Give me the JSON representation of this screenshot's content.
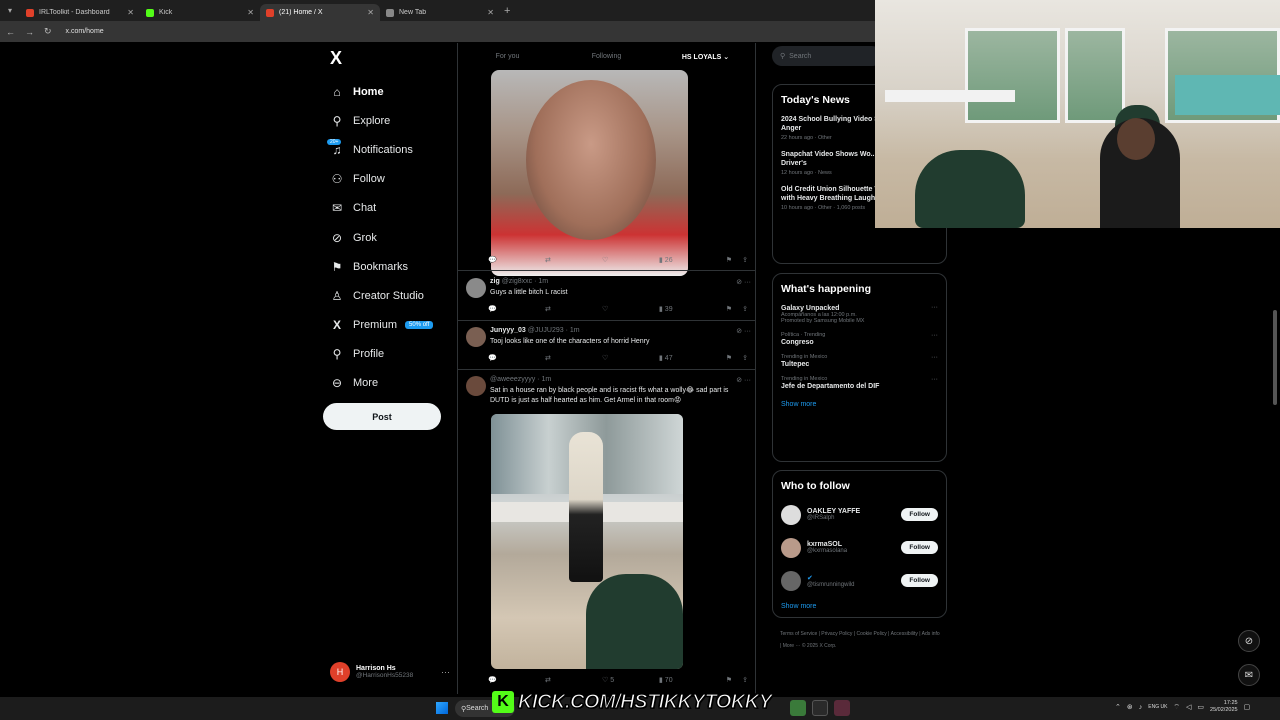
{
  "browser": {
    "tabs": [
      {
        "label": "IRLToolkit - Dashboard",
        "color": "#e0402a"
      },
      {
        "label": "Kick",
        "color": "#53fc18"
      },
      {
        "label": "(21) Home / X",
        "color": "#e0402a",
        "active": true
      },
      {
        "label": "New Tab",
        "color": "#888888"
      }
    ],
    "url": "x.com/home"
  },
  "sidebar": {
    "logo": "X",
    "items": [
      {
        "label": "Home",
        "icon": "home-icon",
        "glyph": "⌂"
      },
      {
        "label": "Explore",
        "icon": "search-icon",
        "glyph": "⚲"
      },
      {
        "label": "Notifications",
        "icon": "bell-icon",
        "glyph": "🔔",
        "badge": "20+"
      },
      {
        "label": "Follow",
        "icon": "follow-icon",
        "glyph": "👤"
      },
      {
        "label": "Chat",
        "icon": "mail-icon",
        "glyph": "✉"
      },
      {
        "label": "Grok",
        "icon": "grok-icon",
        "glyph": "⊘"
      },
      {
        "label": "Bookmarks",
        "icon": "bookmark-icon",
        "glyph": "🔖"
      },
      {
        "label": "Creator Studio",
        "icon": "creator-studio-icon",
        "glyph": "♙"
      },
      {
        "label": "Premium",
        "icon": "premium-x-icon",
        "glyph": "X",
        "pill": "50% off"
      },
      {
        "label": "Profile",
        "icon": "profile-icon",
        "glyph": "👤"
      },
      {
        "label": "More",
        "icon": "more-icon",
        "glyph": "⊖"
      }
    ],
    "post_label": "Post",
    "account": {
      "initial": "H",
      "name": "Harrison Hs",
      "handle": "@HarrisonHs55238"
    }
  },
  "feed": {
    "tabs": [
      "For you",
      "Following",
      "HS LOYALS ⌄"
    ],
    "actions1": {
      "views": "26"
    },
    "tweets": [
      {
        "name": "zig",
        "handle": "@zig8xxc",
        "time": "1m",
        "text": "Guys a little bitch L racist",
        "views": "39"
      },
      {
        "name": "Junyyy_03",
        "handle": "@JUJU293",
        "time": "1m",
        "text": "Tooj looks like one of the characters of horrid Henry",
        "views": "47"
      },
      {
        "name": "",
        "handle": "@aweeezyyyy",
        "time": "1m",
        "text": "Sat in a house ran by black people and is racist ffs what a wolly😂 sad part is DUTD is just as half hearted as him. Get Armel in that room😡",
        "likes": "5",
        "views": "70"
      }
    ]
  },
  "right": {
    "search_placeholder": "Search",
    "news": {
      "title": "Today's News",
      "items": [
        {
          "title": "2024 School Bullying Video Sparks Renewed Anger",
          "meta": "22 hours ago · Other"
        },
        {
          "title": "Snapchat Video Shows Wo... Gun at Rideshare Driver's",
          "meta": "12 hours ago · News"
        },
        {
          "title": "Old Credit Union Silhouette Video Resurfaces with Heavy Breathing Laughs",
          "meta": "10 hours ago · Other · 1,060 posts"
        }
      ]
    },
    "happening": {
      "title": "What's happening",
      "items": [
        {
          "ctx": "",
          "name": "Galaxy Unpacked",
          "sub": "Acompáñanos a las 12:00 p.m.",
          "sub2": "Promoted by Samsung Mobile MX"
        },
        {
          "ctx": "Política · Trending",
          "name": "Congreso",
          "sub": ""
        },
        {
          "ctx": "Trending in Mexico",
          "name": "Tultepec",
          "sub": ""
        },
        {
          "ctx": "Trending in Mexico",
          "name": "Jefe de Departamento del DIF",
          "sub": ""
        }
      ],
      "show_more": "Show more"
    },
    "who_to_follow": {
      "title": "Who to follow",
      "items": [
        {
          "name": "OAKLEY YAFFE",
          "handle": "@IRSalph",
          "button": "Follow"
        },
        {
          "name": "kxrmaSOL",
          "handle": "@kxrmasolana",
          "button": "Follow"
        },
        {
          "name": "",
          "handle": "@tismrunningwild",
          "button": "Follow"
        }
      ],
      "show_more": "Show more"
    },
    "footer": "Terms of Service | Privacy Policy | Cookie Policy | Accessibility | Ads info | More ··· © 2025 X Corp."
  },
  "overlay": {
    "kick_text": "KICK.COM/HSTIKKYTOKKY"
  },
  "taskbar": {
    "search": "Search",
    "lang": "ENG\nUK",
    "time": "17:25",
    "date": "25/02/2025"
  }
}
